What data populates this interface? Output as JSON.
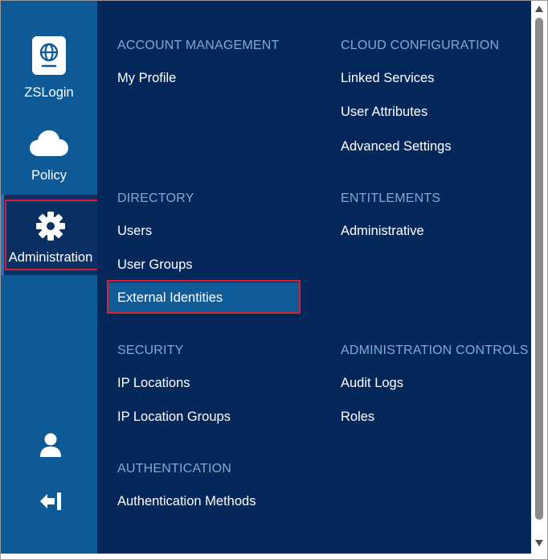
{
  "sidebar": {
    "items": [
      {
        "label": "ZSLogin",
        "icon": "passport-globe-icon"
      },
      {
        "label": "Policy",
        "icon": "cloud-icon"
      },
      {
        "label": "Administration",
        "icon": "gear-icon",
        "active": true
      }
    ],
    "bottom_icons": [
      "user-icon",
      "sign-out-icon"
    ]
  },
  "menu": {
    "account_management": {
      "title": "ACCOUNT MANAGEMENT",
      "items": [
        "My Profile"
      ]
    },
    "cloud_configuration": {
      "title": "CLOUD CONFIGURATION",
      "items": [
        "Linked Services",
        "User Attributes",
        "Advanced Settings"
      ]
    },
    "directory": {
      "title": "DIRECTORY",
      "items": [
        "Users",
        "User Groups",
        "External Identities"
      ],
      "selected": "External Identities"
    },
    "entitlements": {
      "title": "ENTITLEMENTS",
      "items": [
        "Administrative"
      ]
    },
    "security": {
      "title": "SECURITY",
      "items": [
        "IP Locations",
        "IP Location Groups"
      ]
    },
    "administration_controls": {
      "title": "ADMINISTRATION CONTROLS",
      "items": [
        "Audit Logs",
        "Roles"
      ]
    },
    "authentication": {
      "title": "AUTHENTICATION",
      "items": [
        "Authentication Methods"
      ]
    }
  },
  "colors": {
    "sidebar_bg": "#0e5a96",
    "menu_bg": "#04285a",
    "section_title": "#7ea9d6",
    "selected_bg": "#0f5c98",
    "highlight": "#d91f35"
  }
}
